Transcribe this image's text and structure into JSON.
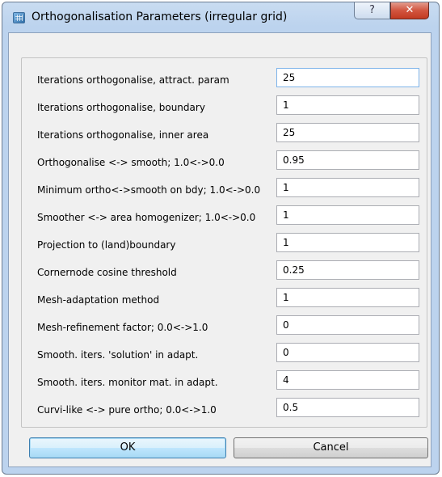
{
  "window": {
    "title": "Orthogonalisation Parameters (irregular grid)",
    "help_glyph": "?",
    "close_glyph": "✕"
  },
  "params": [
    {
      "label": "Iterations orthogonalise, attract. param",
      "value": "25"
    },
    {
      "label": "Iterations orthogonalise, boundary",
      "value": "1"
    },
    {
      "label": "Iterations orthogonalise, inner area",
      "value": "25"
    },
    {
      "label": "Orthogonalise <-> smooth; 1.0<->0.0",
      "value": "0.95"
    },
    {
      "label": "Minimum ortho<->smooth on bdy; 1.0<->0.0",
      "value": "1"
    },
    {
      "label": "Smoother <-> area homogenizer; 1.0<->0.0",
      "value": "1"
    },
    {
      "label": "Projection to (land)boundary",
      "value": "1"
    },
    {
      "label": "Cornernode cosine threshold",
      "value": "0.25"
    },
    {
      "label": "Mesh-adaptation method",
      "value": "1"
    },
    {
      "label": "Mesh-refinement factor; 0.0<->1.0",
      "value": "0"
    },
    {
      "label": "Smooth. iters. 'solution'  in adapt.",
      "value": "0"
    },
    {
      "label": "Smooth. iters. monitor mat.   in adapt.",
      "value": "4"
    },
    {
      "label": "Curvi-like <-> pure ortho;    0.0<->1.0",
      "value": "0.5"
    }
  ],
  "buttons": {
    "ok": "OK",
    "cancel": "Cancel"
  }
}
